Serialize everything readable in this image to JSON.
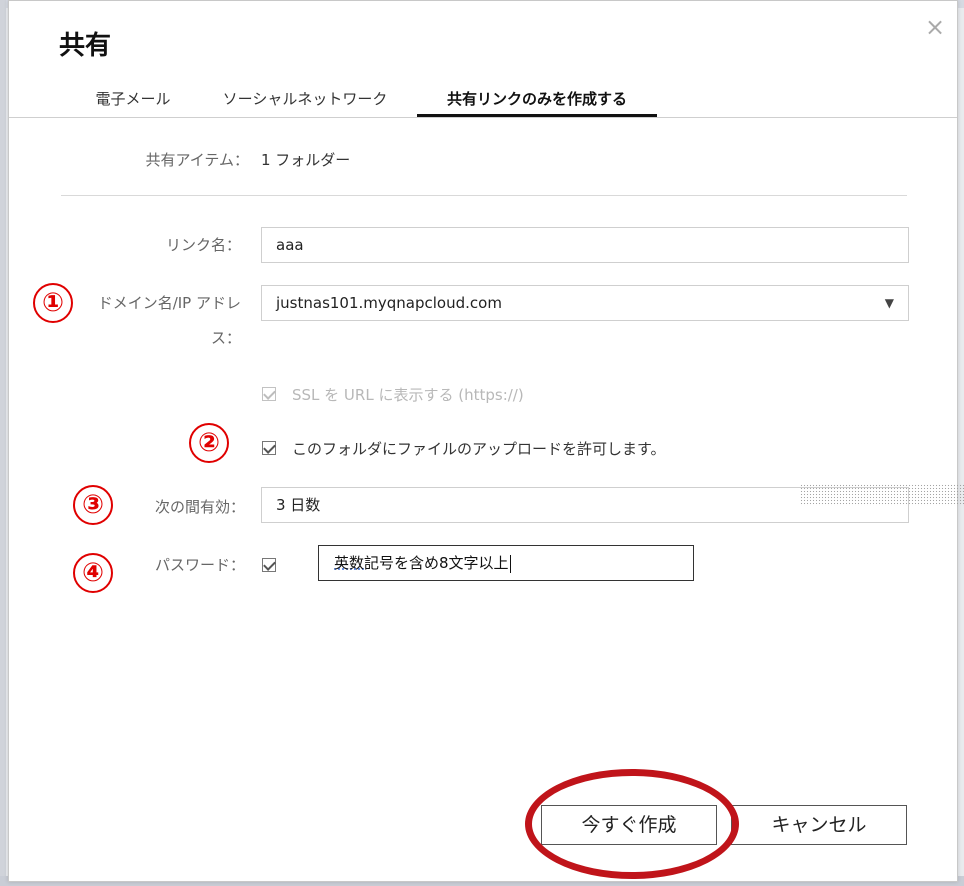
{
  "dialog": {
    "title": "共有",
    "close_glyph": "×"
  },
  "tabs": [
    {
      "label": "電子メール",
      "active": false
    },
    {
      "label": "ソーシャルネットワーク",
      "active": false
    },
    {
      "label": "共有リンクのみを作成する",
      "active": true
    }
  ],
  "share_item": {
    "label": "共有アイテム：",
    "value": "1 フォルダー"
  },
  "link_name": {
    "label": "リンク名：",
    "value": "aaa"
  },
  "domain": {
    "label_line1": "ドメイン名/IP アドレ",
    "label_line2": "ス：",
    "value": "justnas101.myqnapcloud.com",
    "arrow": "▼"
  },
  "ssl": {
    "label": "SSL を URL に表示する (https://)",
    "checked": true,
    "disabled": true
  },
  "upload": {
    "label": "このフォルダにファイルのアップロードを許可します。",
    "checked": true
  },
  "expiry": {
    "label": "次の間有効：",
    "value": "3 日数"
  },
  "password": {
    "label": "パスワード：",
    "checked": true,
    "value_underlined": "英数",
    "value_rest": "記号を含め8文字以上"
  },
  "markers": [
    "①",
    "②",
    "③",
    "④"
  ],
  "buttons": {
    "create_label": "今すぐ作成",
    "cancel_label": "キャンセル"
  },
  "colors": {
    "marker_red": "#e00000",
    "ellipse_red": "#c0141a"
  }
}
